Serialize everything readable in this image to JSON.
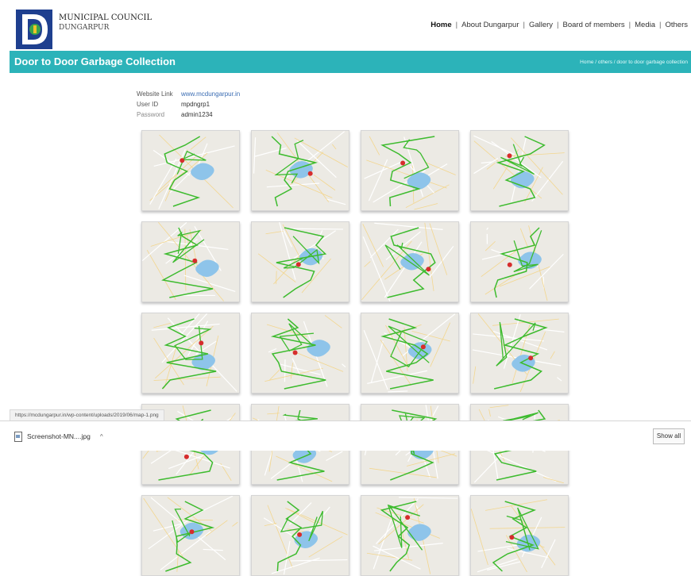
{
  "header": {
    "org_name": "MUNICIPAL COUNCIL",
    "org_city": "DUNGARPUR",
    "nav": [
      "Home",
      "About Dungarpur",
      "Gallery",
      "Board of members",
      "Media",
      "Others"
    ]
  },
  "titlebar": {
    "title": "Door to Door Garbage Collection",
    "breadcrumb": "Home / others / door to door garbage collection"
  },
  "info": {
    "rows": [
      {
        "label": "Website Link",
        "value": "www.mcdungarpur.in"
      },
      {
        "label": "User ID",
        "value": "mpdngrp1"
      },
      {
        "label": "Password",
        "value": "admin1234"
      }
    ]
  },
  "gallery": {
    "item_count": 20
  },
  "status_url": "https://mcdungarpur.in/wp-content/uploads/2019/06/map-1.png",
  "download": {
    "file_name": "Screenshot-MN....jpg",
    "show_all": "Show all"
  },
  "colors": {
    "teal": "#2cb3b9",
    "route": "#3dbb2e",
    "lake": "#8ec4ea",
    "marker": "#d62d2d"
  }
}
